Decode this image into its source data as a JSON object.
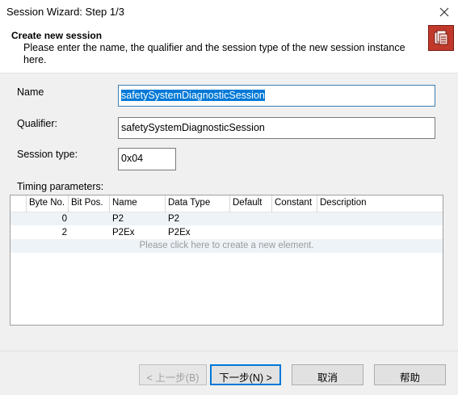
{
  "window": {
    "title": "Session Wizard: Step 1/3"
  },
  "header": {
    "title": "Create new session",
    "description": "Please enter the name, the qualifier and the session type of the new session instance here."
  },
  "form": {
    "name_label": "Name",
    "name_value": "safetySystemDiagnosticSession",
    "qualifier_label": "Qualifier:",
    "qualifier_value": "safetySystemDiagnosticSession",
    "session_type_label": "Session type:",
    "session_type_value": "0x04",
    "timing_label": "Timing parameters:"
  },
  "table": {
    "columns": [
      "Byte No.",
      "Bit Pos.",
      "Name",
      "Data Type",
      "Default",
      "Constant",
      "Description"
    ],
    "rows": [
      {
        "byte_no": "0",
        "bit_pos": "",
        "name": "P2",
        "data_type": "P2",
        "default": "",
        "constant": "",
        "description": ""
      },
      {
        "byte_no": "2",
        "bit_pos": "",
        "name": "P2Ex",
        "data_type": "P2Ex",
        "default": "",
        "constant": "",
        "description": ""
      }
    ],
    "new_element_hint": "Please click here to create a new element."
  },
  "buttons": {
    "back": "< 上一步(B)",
    "next": "下一步(N) >",
    "cancel": "取消",
    "help": "帮助"
  },
  "icons": {
    "close": "close-icon",
    "logo": "session-wizard-logo-icon"
  },
  "colors": {
    "selection": "#0078d7",
    "logo": "#c0392b"
  }
}
